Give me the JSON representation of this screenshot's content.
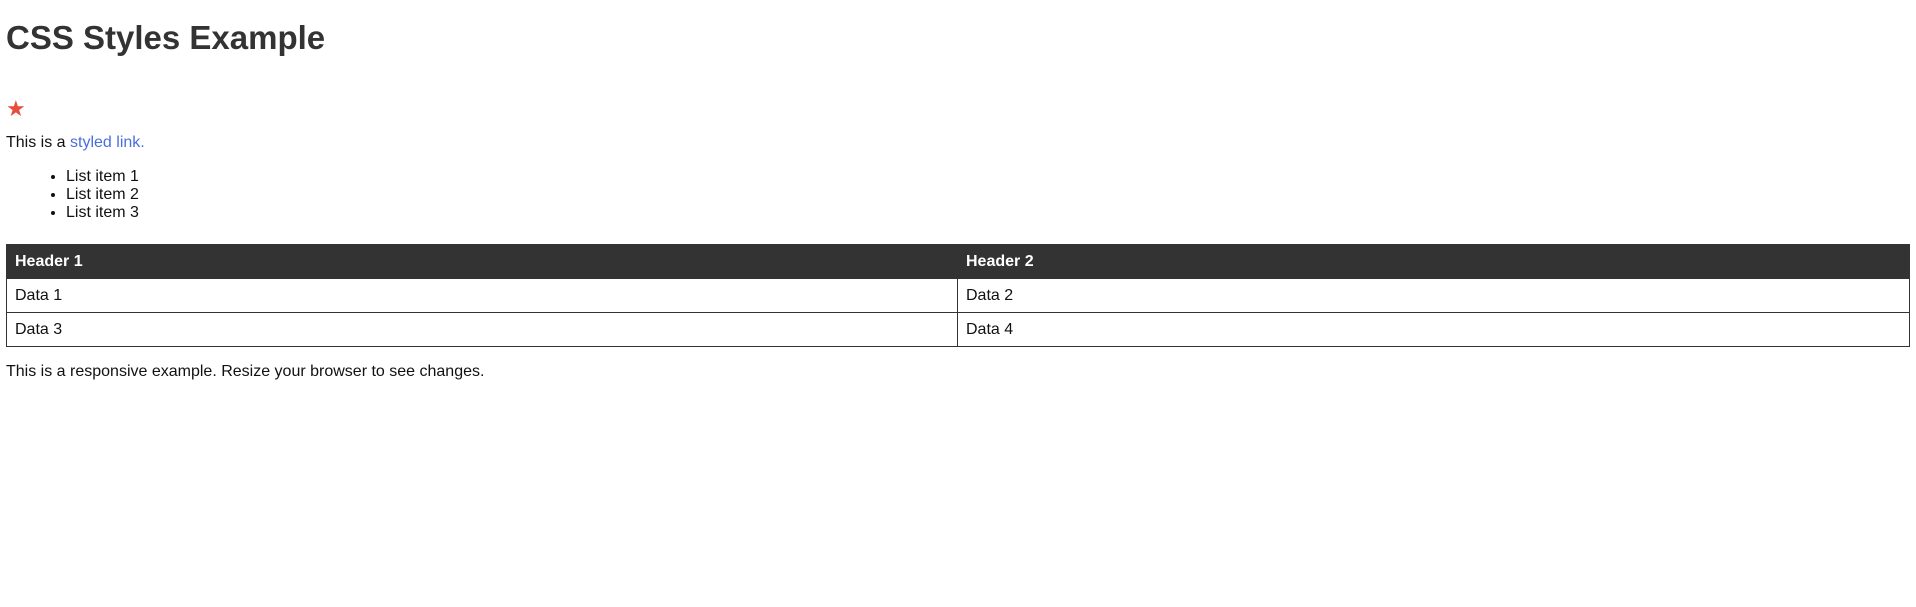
{
  "page": {
    "title": "CSS Styles Example",
    "star_icon": "star-icon",
    "accent_color": "#e74c3c",
    "link_color": "#4a6fdc"
  },
  "intro": {
    "prefix": "This is a ",
    "link_text": "styled link."
  },
  "list": {
    "items": [
      "List item 1",
      "List item 2",
      "List item 3"
    ]
  },
  "table": {
    "headers": [
      "Header 1",
      "Header 2"
    ],
    "rows": [
      [
        "Data 1",
        "Data 2"
      ],
      [
        "Data 3",
        "Data 4"
      ]
    ]
  },
  "footer": {
    "text": "This is a responsive example. Resize your browser to see changes."
  }
}
